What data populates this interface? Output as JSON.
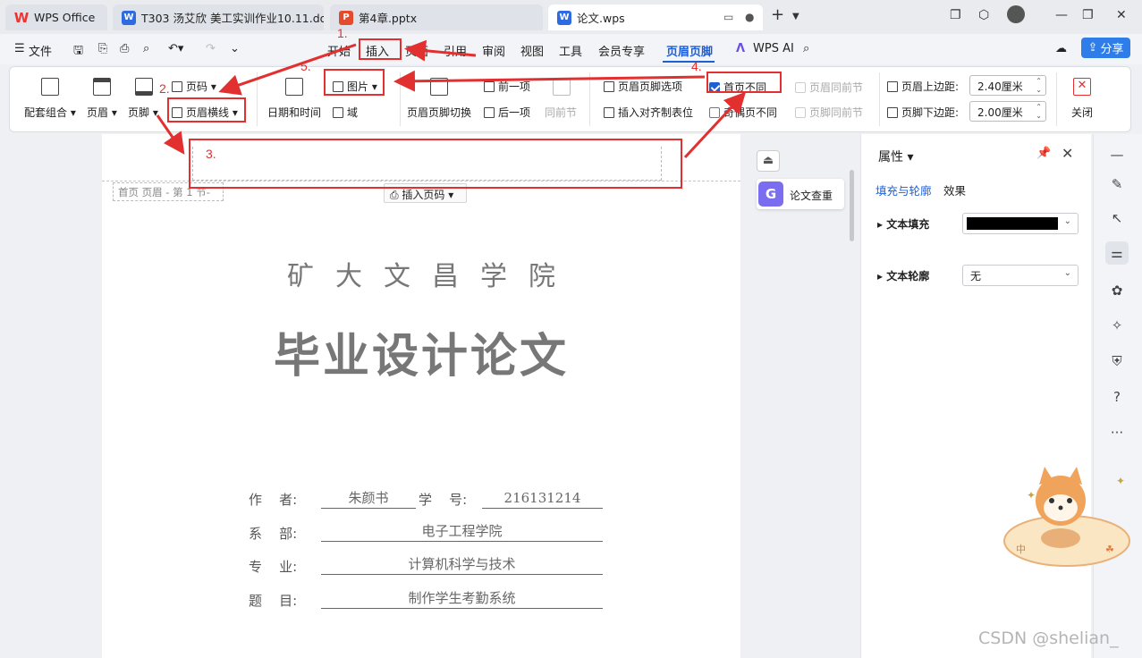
{
  "tabs": [
    {
      "label": "WPS Office",
      "icon": "wps-logo-icon"
    },
    {
      "label": "T303 汤艾欣 美工实训作业10.11.doc",
      "icon": "word-doc-icon"
    },
    {
      "label": "第4章.pptx",
      "icon": "ppt-doc-icon"
    },
    {
      "label": "论文.wps",
      "icon": "word-doc-icon"
    }
  ],
  "menu": {
    "file": "文件",
    "items": [
      "开始",
      "插入",
      "页面",
      "引用",
      "审阅",
      "视图",
      "工具",
      "会员专享",
      "页眉页脚"
    ],
    "wps_ai": "WPS AI",
    "share": "分享"
  },
  "ribbon": {
    "combo": "配套组合",
    "header": "页眉",
    "footer": "页脚",
    "page_num": "页码",
    "header_line": "页眉横线",
    "datetime": "日期和时间",
    "picture": "图片",
    "field": "域",
    "switch": "页眉页脚切换",
    "prev": "前一项",
    "next": "后一项",
    "same_prev": "同前节",
    "hf_options": "页眉页脚选项",
    "insert_align_tab": "插入对齐制表位",
    "first_diff": "首页不同",
    "odd_even_diff": "奇偶页不同",
    "header_same_prev": "页眉同前节",
    "footer_same_prev": "页脚同前节",
    "header_margin_label": "页眉上边距:",
    "header_margin": "2.40厘米",
    "footer_margin_label": "页脚下边距:",
    "footer_margin": "2.00厘米",
    "close": "关闭"
  },
  "document": {
    "header_tag": "首页 页眉  - 第 1 节-",
    "insert_page_num": "插入页码",
    "school": "矿大文昌学院",
    "thesis_title": "毕业设计论文",
    "fields": [
      {
        "label": "作    者:",
        "value": "朱颜书"
      },
      {
        "label": "学    号:",
        "value": "216131214"
      },
      {
        "label": "系    部:",
        "value": "电子工程学院"
      },
      {
        "label": "专    业:",
        "value": "计算机科学与技术"
      },
      {
        "label": "题    目:",
        "value": "制作学生考勤系统"
      }
    ]
  },
  "side": {
    "paper_check": "论文查重"
  },
  "properties": {
    "title": "属性",
    "tab_fill": "填充与轮廓",
    "tab_effect": "效果",
    "text_fill": "文本填充",
    "text_fill_color": "#000000",
    "text_outline": "文本轮廓",
    "text_outline_value": "无"
  },
  "annotations": [
    "1.",
    "2.",
    "3.",
    "4.",
    "5."
  ],
  "watermark": "CSDN @shelian_",
  "colors": {
    "accent": "#1f5fd6",
    "annotation": "#e23030"
  }
}
